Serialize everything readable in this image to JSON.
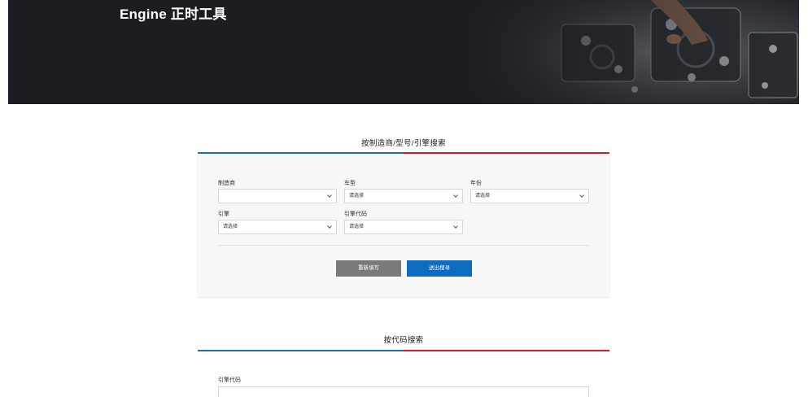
{
  "hero": {
    "title": "Engine 正时工具"
  },
  "section1": {
    "title": "按制造商/型号/引擎搜索",
    "fields": {
      "manufacturer": {
        "label": "制造商",
        "value": ""
      },
      "model": {
        "label": "车型",
        "value": "请选择"
      },
      "year": {
        "label": "年份",
        "value": "请选择"
      },
      "engine": {
        "label": "引擎",
        "value": "请选择"
      },
      "engine_code": {
        "label": "引擎代码",
        "value": "请选择"
      }
    },
    "reset_label": "重新填写",
    "submit_label": "送出搜寻"
  },
  "section2": {
    "title": "按代码搜索",
    "field_label": "引擎代码"
  },
  "colors": {
    "hero_bg": "#1b1d23",
    "accent_blue": "#1a6bb5",
    "accent_red": "#d21f26",
    "submit_blue": "#0e6cc0",
    "reset_gray": "#7a7a7a"
  }
}
